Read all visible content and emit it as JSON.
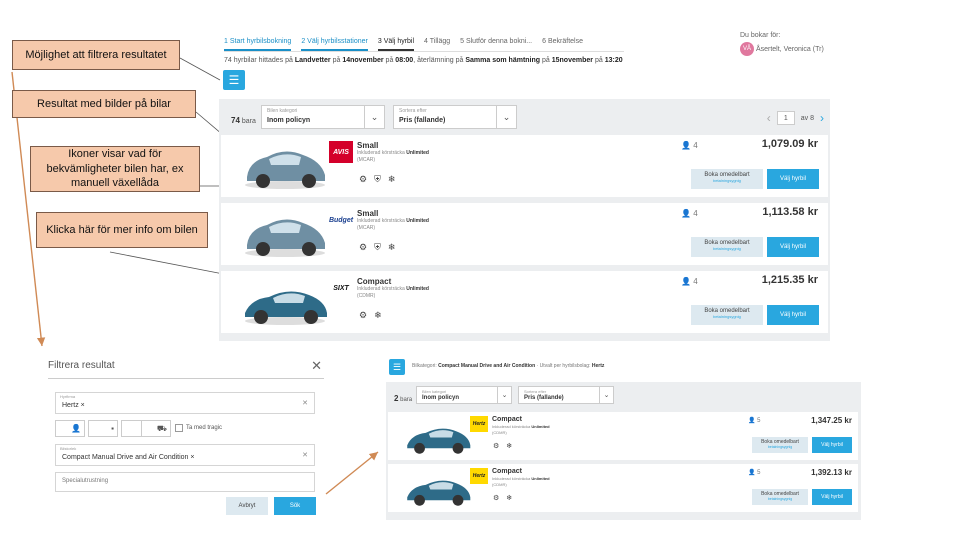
{
  "callouts": {
    "filter": "Möjlighet att filtrera resultatet",
    "images": "Resultat med bilder på bilar",
    "icons": "Ikoner visar vad för bekvämligheter bilen har, ex manuell växellåda",
    "more_info": "Klicka här för mer info om bilen"
  },
  "top": {
    "steps": [
      "1 Start hyrbilsbokning",
      "2 Välj hyrbilsstationer",
      "3 Välj hyrbil",
      "4 Tillägg",
      "5 Slutför denna bokni...",
      "6 Bekräftelse"
    ],
    "booker_label": "Du bokar för:",
    "booker_initials": "VÅ",
    "booker_name": "Åsertelt, Veronica (Tr)",
    "subline_pre": "74 hyrbilar hittades på",
    "pickup_station": "Landvetter",
    "subline_mid1": "på",
    "pickup_date": "14november",
    "subline_mid2": "på",
    "pickup_time": "08:00",
    "subline_mid3": ", återlämning på",
    "return_station": "Samma som hämtning",
    "subline_mid4": "på",
    "return_date": "15november",
    "subline_mid5": "på",
    "return_time": "13:20",
    "count_num": "74",
    "count_unit": "bara",
    "category_label": "Bilen kategori",
    "category_value": "Inom policyn",
    "sort_label": "Sortera efter",
    "sort_value": "Pris (fallande)",
    "page_value": "1",
    "page_total": "av 8",
    "book_later": "Boka omedelbart",
    "book_later_sub": "betalningsygnig",
    "choose": "Välj hyrbil",
    "cars": [
      {
        "name": "Small",
        "vendor": "AVIS",
        "included": "Inkluderad körsträcka",
        "mileage": "Unlimited",
        "code": "(MCAR)",
        "pax": "4",
        "price": "1,079.09 kr"
      },
      {
        "name": "Small",
        "vendor": "Budget",
        "included": "Inkluderad körsträcka",
        "mileage": "Unlimited",
        "code": "(MCAR)",
        "pax": "4",
        "price": "1,113.58 kr"
      },
      {
        "name": "Compact",
        "vendor": "SIXT",
        "included": "Inkluderad körsträcka",
        "mileage": "Unlimited",
        "code": "(CDMR)",
        "pax": "4",
        "price": "1,215.35 kr"
      }
    ]
  },
  "filter_panel": {
    "title": "Filtrera resultat",
    "vendor_label": "Hyrfirma",
    "vendor_tag": "Hertz",
    "checkbox_label": "Ta med tragic",
    "category_label": "Bilstorlek",
    "category_tag": "Compact Manual Drive and Air Condition",
    "special_label": "Specialutrustning",
    "cancel": "Avbryt",
    "ok": "Sök"
  },
  "bottom": {
    "info_pre": "Bilkategori:",
    "info_cat": "Compact Manual Drive and Air Condition",
    "info_mid": "· Utvalt per hyrbilsbolag:",
    "info_vendor": "Hertz",
    "count_num": "2",
    "count_unit": "bara",
    "category_label": "Bilen kategori",
    "category_value": "Inom policyn",
    "sort_label": "Sortera efter",
    "sort_value": "Pris (fallande)",
    "book_later": "Boka omedelbart",
    "book_later_sub": "betalningsygnig",
    "choose": "Välj hyrbil",
    "cars": [
      {
        "name": "Compact",
        "vendor": "Hertz",
        "included": "Inkluderad körsträcka",
        "mileage": "Unlimited",
        "code": "(CDMR)",
        "pax": "5",
        "price": "1,347.25 kr"
      },
      {
        "name": "Compact",
        "vendor": "Hertz",
        "included": "Inkluderad körsträcka",
        "mileage": "Unlimited",
        "code": "(CDMR)",
        "pax": "5",
        "price": "1,392.13 kr"
      }
    ]
  }
}
